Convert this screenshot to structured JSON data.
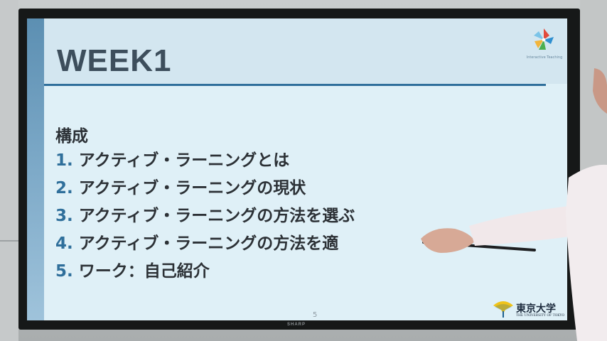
{
  "slide": {
    "title": "WEEK1",
    "heading": "構成",
    "items": [
      {
        "num": "1.",
        "text": "アクティブ・ラーニングとは"
      },
      {
        "num": "2.",
        "text": "アクティブ・ラーニングの現状"
      },
      {
        "num": "3.",
        "text": "アクティブ・ラーニングの方法を選ぶ"
      },
      {
        "num": "4.",
        "text": "アクティブ・ラーニングの方法を適"
      },
      {
        "num": "5.",
        "text": "ワーク：自己紹介"
      }
    ],
    "page_number": "5",
    "top_logo_caption": "Interactive Teaching",
    "university_name": "東京大学",
    "university_sub": "THE UNIVERSITY OF TOKYO"
  },
  "monitor": {
    "brand": "SHARP"
  },
  "colors": {
    "accent": "#2f6f9b",
    "title_text": "#3d4e5c",
    "body_text": "#2c3136",
    "slide_background": "#dff0f7"
  },
  "icons": [
    "interactive-teaching-logo-icon",
    "ginkgo-leaf-icon"
  ]
}
